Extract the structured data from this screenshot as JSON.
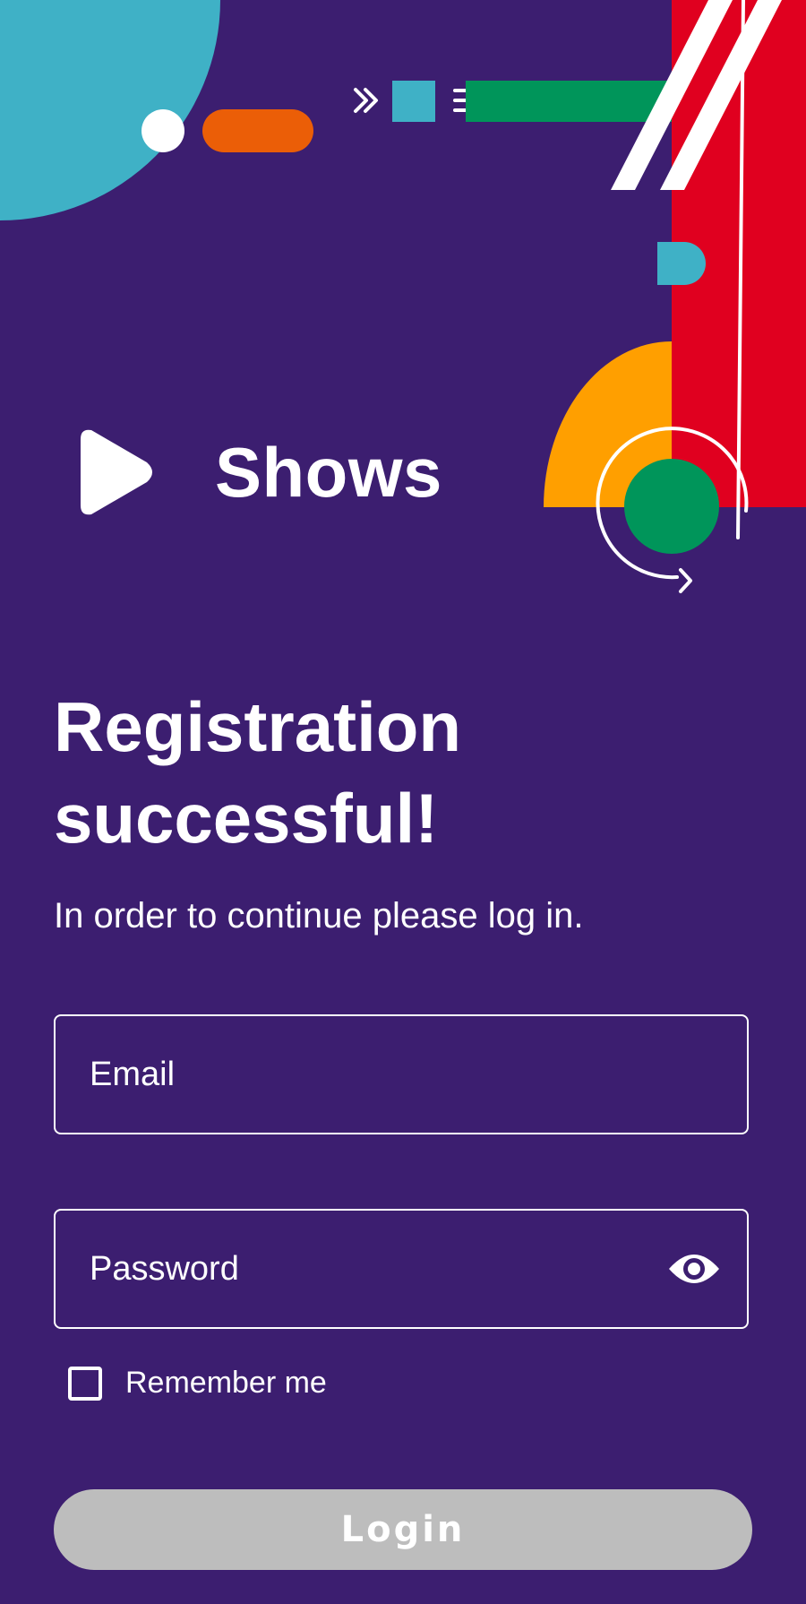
{
  "app": {
    "title": "Shows",
    "logo_icon": "play-icon"
  },
  "main": {
    "heading_line1": "Registration",
    "heading_line2": "successful!",
    "subtitle": "In order to continue please log in."
  },
  "form": {
    "email_placeholder": "Email",
    "email_value": "",
    "password_placeholder": "Password",
    "password_value": "",
    "password_toggle_icon": "eye-icon",
    "remember_label": "Remember me",
    "remember_checked": false,
    "login_label": "Login",
    "login_enabled": false
  },
  "colors": {
    "background": "#3c1e70",
    "accent_teal": "#3fb1c6",
    "accent_orange": "#eb5e07",
    "accent_green": "#00955a",
    "accent_red": "#e0001f",
    "accent_yellow": "#ff9f00",
    "button_disabled": "#bdbdbd"
  }
}
